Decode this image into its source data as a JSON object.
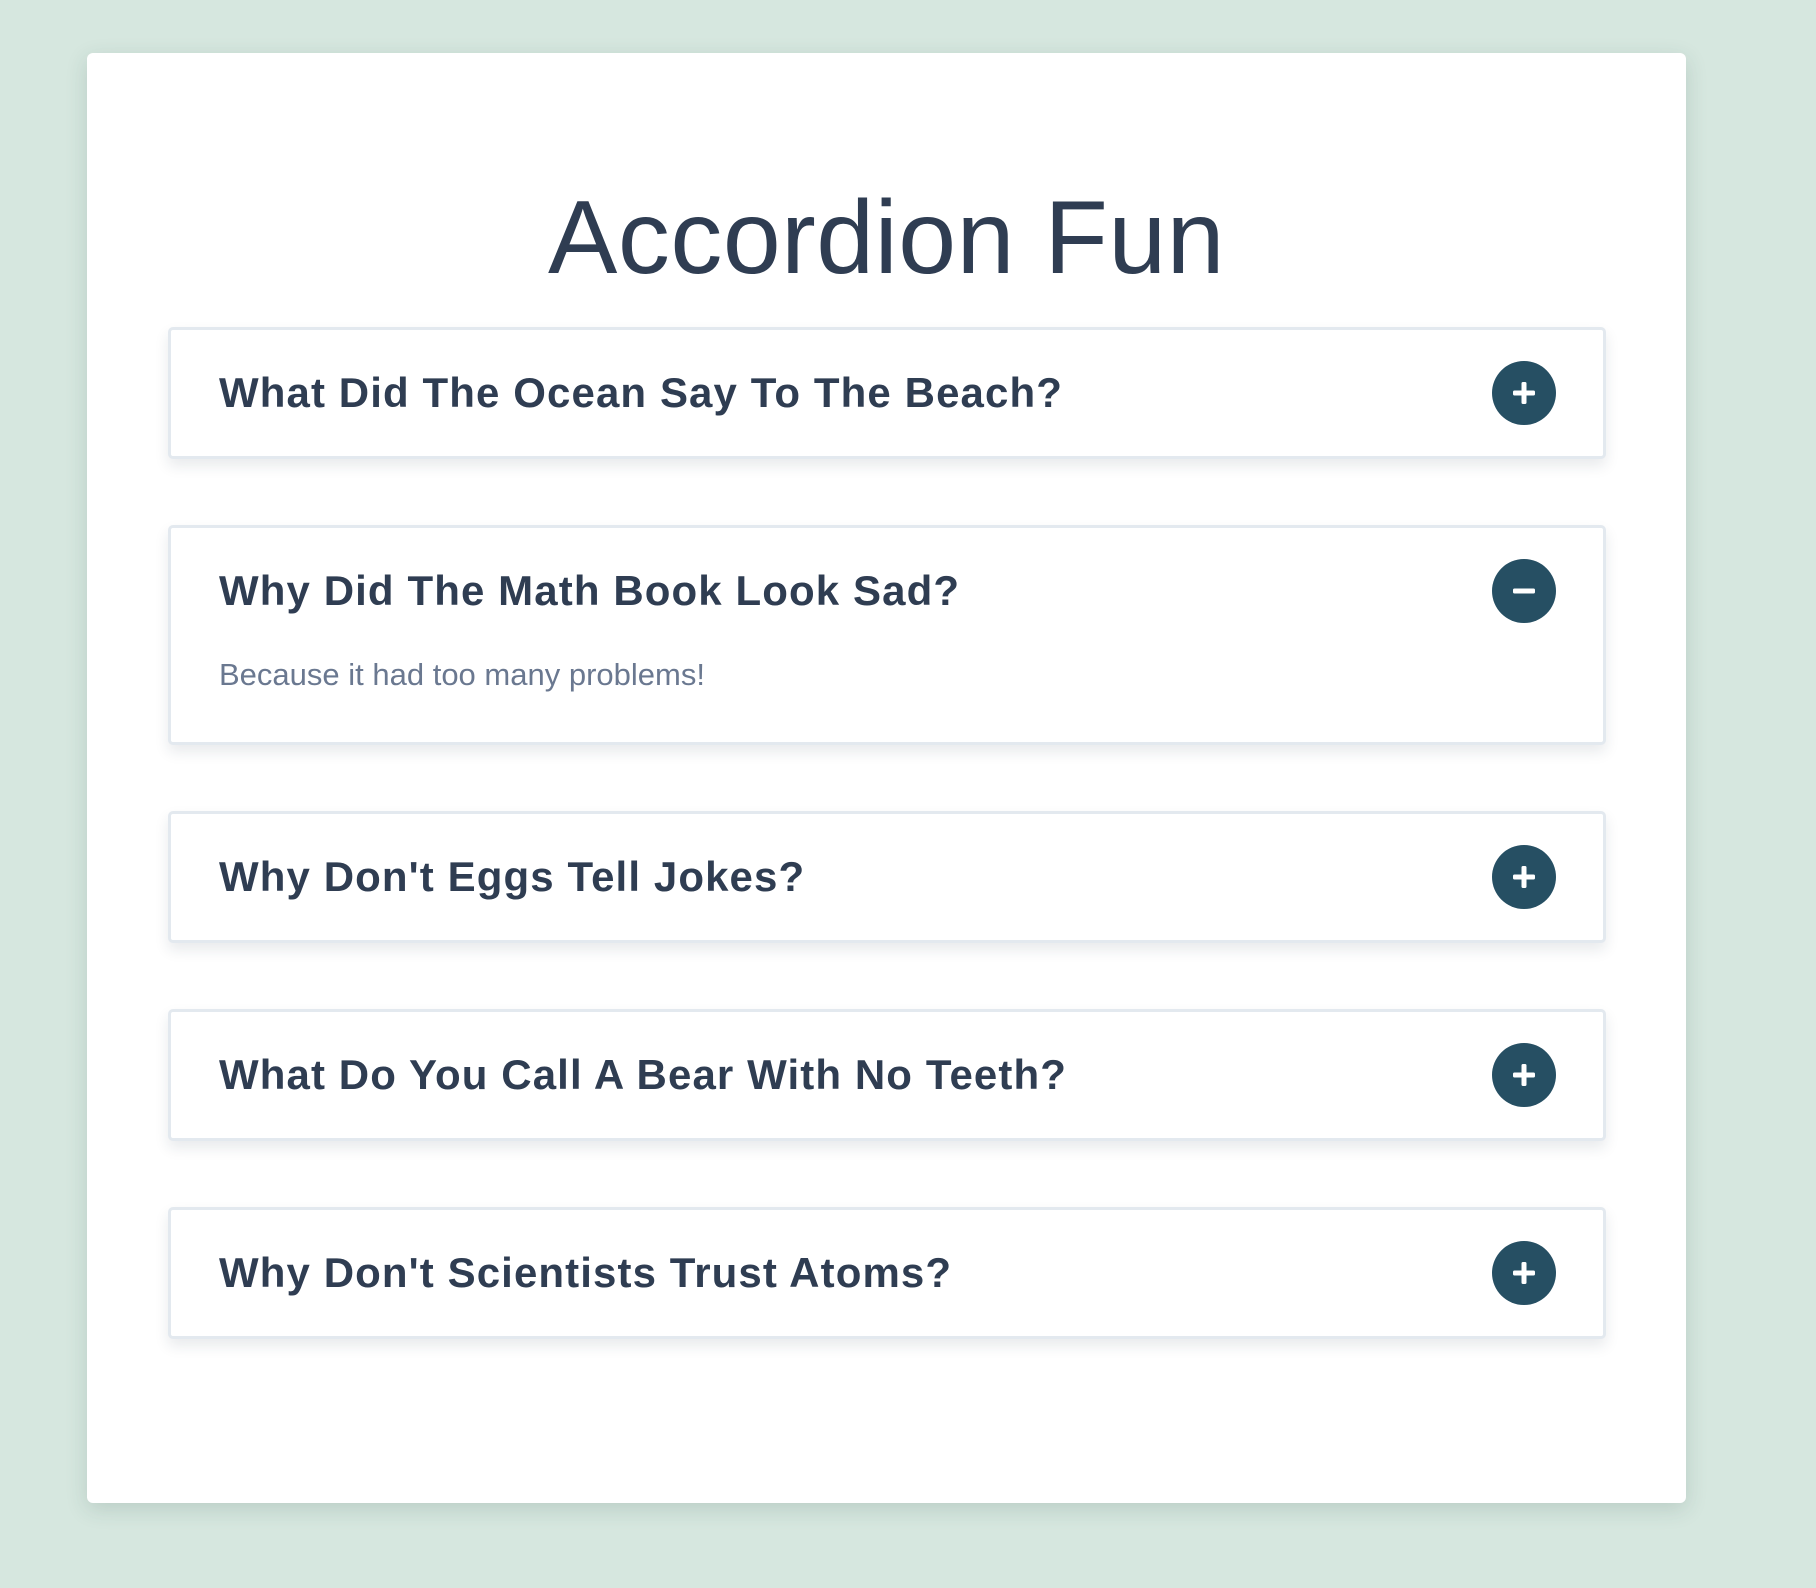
{
  "page": {
    "title": "Accordion Fun"
  },
  "colors": {
    "background": "#d6e7df",
    "card": "#ffffff",
    "heading_text": "#2f3d52",
    "answer_text": "#6a7890",
    "toggle_button": "#264f63",
    "item_border": "#e3e9ef"
  },
  "accordion": {
    "items": [
      {
        "question": "What Did The Ocean Say To The Beach?",
        "expanded": false,
        "toggle_icon": "plus-icon"
      },
      {
        "question": "Why Did The Math Book Look Sad?",
        "answer": "Because it had too many problems!",
        "expanded": true,
        "toggle_icon": "minus-icon"
      },
      {
        "question": "Why Don't Eggs Tell Jokes?",
        "expanded": false,
        "toggle_icon": "plus-icon"
      },
      {
        "question": "What Do You Call A Bear With No Teeth?",
        "expanded": false,
        "toggle_icon": "plus-icon"
      },
      {
        "question": "Why Don't Scientists Trust Atoms?",
        "expanded": false,
        "toggle_icon": "plus-icon"
      }
    ]
  }
}
